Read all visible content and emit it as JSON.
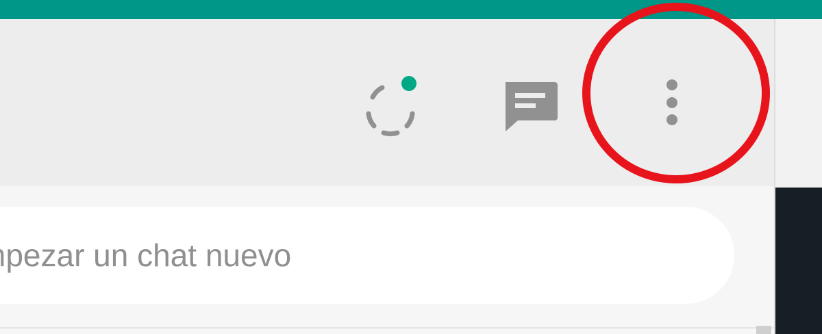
{
  "colors": {
    "accent": "#009688",
    "status_dot": "#00a884",
    "icon_gray": "#919191",
    "highlight_red": "#e8141c",
    "dark_strip": "#161f25"
  },
  "icons": {
    "status": "status-icon",
    "new_chat": "new-chat-icon",
    "menu": "kebab-menu-icon"
  },
  "search": {
    "placeholder": "mpezar un chat nuevo"
  }
}
